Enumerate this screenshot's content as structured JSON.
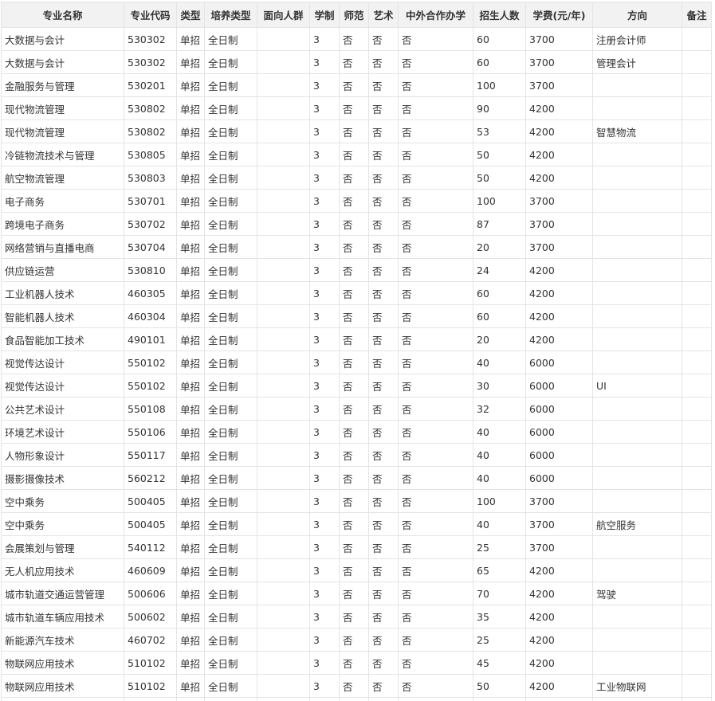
{
  "table": {
    "headers": [
      "专业名称",
      "专业代码",
      "类型",
      "培养类型",
      "面向人群",
      "学制",
      "师范",
      "艺术",
      "中外合作办学",
      "招生人数",
      "学费(元/年)",
      "方向",
      "备注"
    ],
    "rows": [
      [
        "大数据与会计",
        "530302",
        "单招",
        "全日制",
        "",
        "3",
        "否",
        "否",
        "否",
        "60",
        "3700",
        "注册会计师",
        ""
      ],
      [
        "大数据与会计",
        "530302",
        "单招",
        "全日制",
        "",
        "3",
        "否",
        "否",
        "否",
        "60",
        "3700",
        "管理会计",
        ""
      ],
      [
        "金融服务与管理",
        "530201",
        "单招",
        "全日制",
        "",
        "3",
        "否",
        "否",
        "否",
        "100",
        "3700",
        "",
        ""
      ],
      [
        "现代物流管理",
        "530802",
        "单招",
        "全日制",
        "",
        "3",
        "否",
        "否",
        "否",
        "90",
        "4200",
        "",
        ""
      ],
      [
        "现代物流管理",
        "530802",
        "单招",
        "全日制",
        "",
        "3",
        "否",
        "否",
        "否",
        "53",
        "4200",
        "智慧物流",
        ""
      ],
      [
        "冷链物流技术与管理",
        "530805",
        "单招",
        "全日制",
        "",
        "3",
        "否",
        "否",
        "否",
        "50",
        "4200",
        "",
        ""
      ],
      [
        "航空物流管理",
        "530803",
        "单招",
        "全日制",
        "",
        "3",
        "否",
        "否",
        "否",
        "50",
        "4200",
        "",
        ""
      ],
      [
        "电子商务",
        "530701",
        "单招",
        "全日制",
        "",
        "3",
        "否",
        "否",
        "否",
        "100",
        "3700",
        "",
        ""
      ],
      [
        "跨境电子商务",
        "530702",
        "单招",
        "全日制",
        "",
        "3",
        "否",
        "否",
        "否",
        "87",
        "3700",
        "",
        ""
      ],
      [
        "网络营销与直播电商",
        "530704",
        "单招",
        "全日制",
        "",
        "3",
        "否",
        "否",
        "否",
        "20",
        "3700",
        "",
        ""
      ],
      [
        "供应链运营",
        "530810",
        "单招",
        "全日制",
        "",
        "3",
        "否",
        "否",
        "否",
        "24",
        "4200",
        "",
        ""
      ],
      [
        "工业机器人技术",
        "460305",
        "单招",
        "全日制",
        "",
        "3",
        "否",
        "否",
        "否",
        "60",
        "4200",
        "",
        ""
      ],
      [
        "智能机器人技术",
        "460304",
        "单招",
        "全日制",
        "",
        "3",
        "否",
        "否",
        "否",
        "60",
        "4200",
        "",
        ""
      ],
      [
        "食品智能加工技术",
        "490101",
        "单招",
        "全日制",
        "",
        "3",
        "否",
        "否",
        "否",
        "20",
        "4200",
        "",
        ""
      ],
      [
        "视觉传达设计",
        "550102",
        "单招",
        "全日制",
        "",
        "3",
        "否",
        "否",
        "否",
        "40",
        "6000",
        "",
        ""
      ],
      [
        "视觉传达设计",
        "550102",
        "单招",
        "全日制",
        "",
        "3",
        "否",
        "否",
        "否",
        "30",
        "6000",
        "UI",
        ""
      ],
      [
        "公共艺术设计",
        "550108",
        "单招",
        "全日制",
        "",
        "3",
        "否",
        "否",
        "否",
        "32",
        "6000",
        "",
        ""
      ],
      [
        "环境艺术设计",
        "550106",
        "单招",
        "全日制",
        "",
        "3",
        "否",
        "否",
        "否",
        "40",
        "6000",
        "",
        ""
      ],
      [
        "人物形象设计",
        "550117",
        "单招",
        "全日制",
        "",
        "3",
        "否",
        "否",
        "否",
        "40",
        "6000",
        "",
        ""
      ],
      [
        "摄影摄像技术",
        "560212",
        "单招",
        "全日制",
        "",
        "3",
        "否",
        "否",
        "否",
        "40",
        "6000",
        "",
        ""
      ],
      [
        "空中乘务",
        "500405",
        "单招",
        "全日制",
        "",
        "3",
        "否",
        "否",
        "否",
        "100",
        "3700",
        "",
        ""
      ],
      [
        "空中乘务",
        "500405",
        "单招",
        "全日制",
        "",
        "3",
        "否",
        "否",
        "否",
        "40",
        "3700",
        "航空服务",
        ""
      ],
      [
        "会展策划与管理",
        "540112",
        "单招",
        "全日制",
        "",
        "3",
        "否",
        "否",
        "否",
        "25",
        "3700",
        "",
        ""
      ],
      [
        "无人机应用技术",
        "460609",
        "单招",
        "全日制",
        "",
        "3",
        "否",
        "否",
        "否",
        "65",
        "4200",
        "",
        ""
      ],
      [
        "城市轨道交通运营管理",
        "500606",
        "单招",
        "全日制",
        "",
        "3",
        "否",
        "否",
        "否",
        "70",
        "4200",
        "驾驶",
        ""
      ],
      [
        "城市轨道车辆应用技术",
        "500602",
        "单招",
        "全日制",
        "",
        "3",
        "否",
        "否",
        "否",
        "35",
        "4200",
        "",
        ""
      ],
      [
        "新能源汽车技术",
        "460702",
        "单招",
        "全日制",
        "",
        "3",
        "否",
        "否",
        "否",
        "25",
        "4200",
        "",
        ""
      ],
      [
        "物联网应用技术",
        "510102",
        "单招",
        "全日制",
        "",
        "3",
        "否",
        "否",
        "否",
        "45",
        "4200",
        "",
        ""
      ],
      [
        "物联网应用技术",
        "510102",
        "单招",
        "全日制",
        "",
        "3",
        "否",
        "否",
        "否",
        "50",
        "4200",
        "工业物联网",
        ""
      ],
      [
        "",
        "",
        "",
        "",
        "",
        "",
        "",
        "",
        "",
        "",
        "",
        "",
        ""
      ]
    ]
  }
}
